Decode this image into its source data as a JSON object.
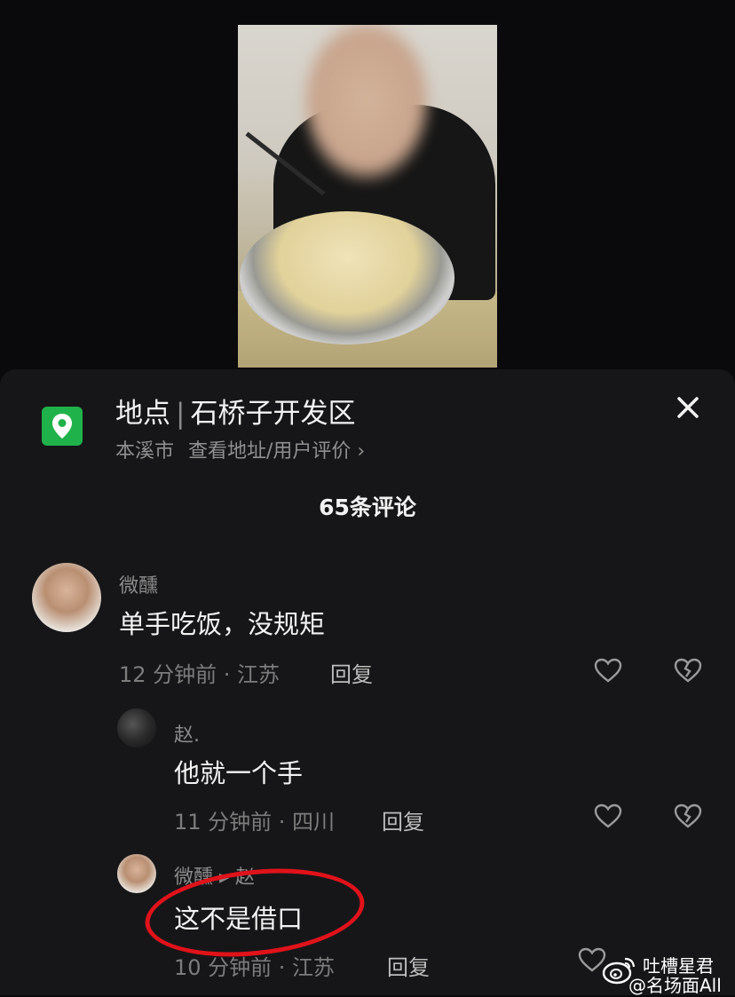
{
  "location": {
    "label": "地点",
    "name": "石桥子开发区",
    "city": "本溪市",
    "link": "查看地址/用户评价 ›"
  },
  "comments_count": "65条评论",
  "comments": [
    {
      "user": "微醺",
      "text": "单手吃饭，没规矩",
      "meta": "12 分钟前 · 江苏",
      "reply": "回复"
    },
    {
      "user": "赵.",
      "text": "他就一个手",
      "meta": "11 分钟前 · 四川",
      "reply": "回复"
    },
    {
      "user": "微醺 ▸ 赵",
      "text": "这不是借口",
      "meta": "10 分钟前 · 江苏",
      "reply": "回复"
    }
  ],
  "watermark": {
    "line1": "吐槽星君",
    "line2": "@名场面All"
  },
  "colors": {
    "accent_green": "#1fb24a",
    "highlight_red": "#e0121a"
  }
}
